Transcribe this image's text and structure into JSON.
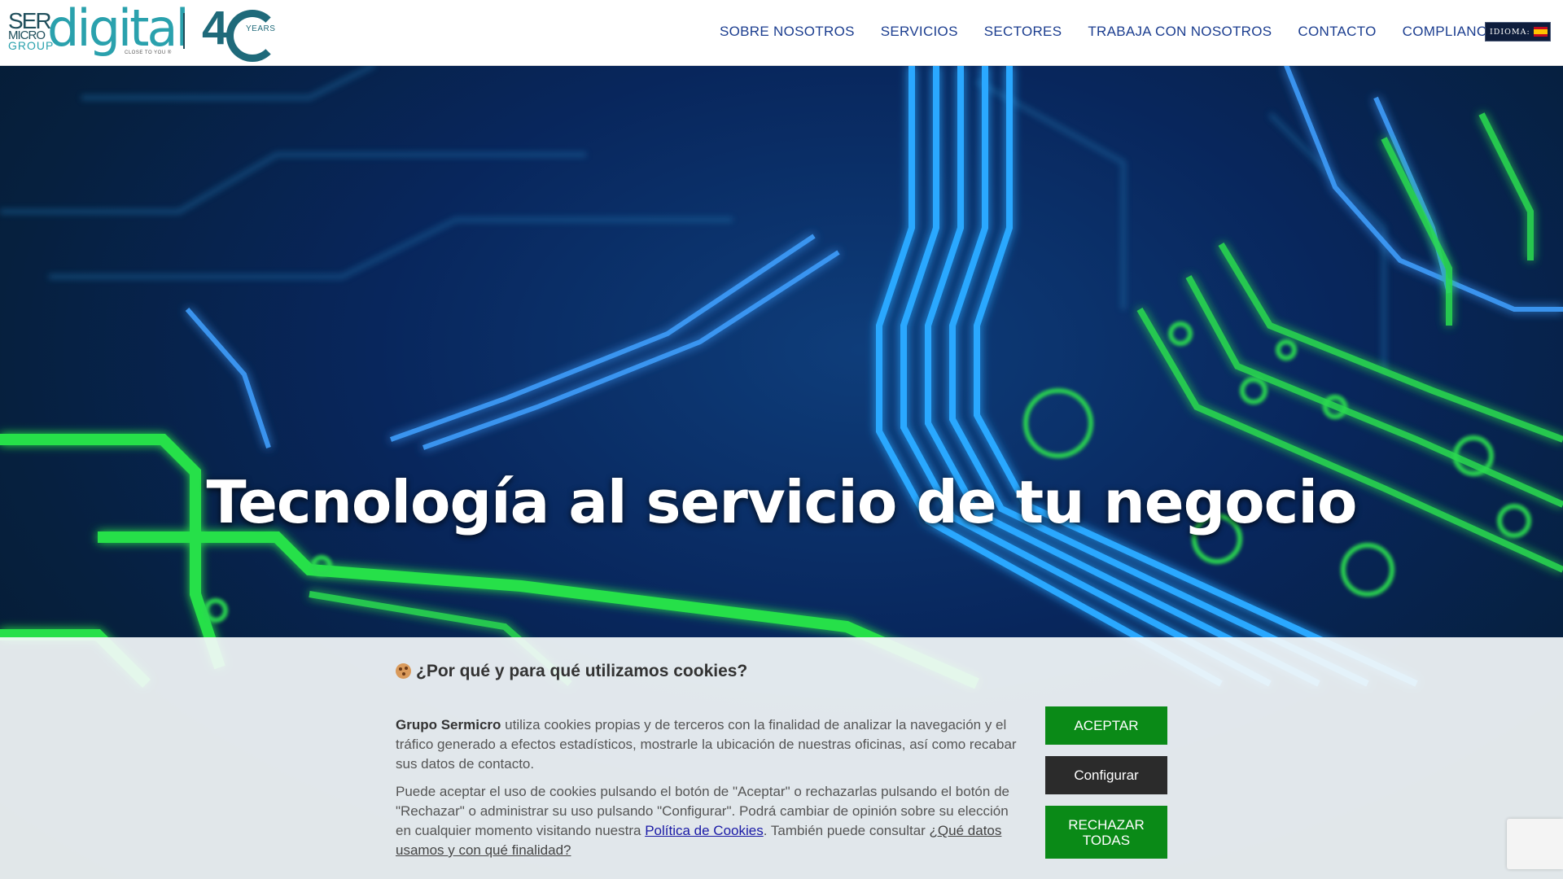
{
  "header": {
    "logo": {
      "ser": "SER",
      "micro": "MICRO",
      "group": "GROUP",
      "digital": "digital",
      "tagline": "CLOSE TO YOU ®",
      "anniversary_number": "4",
      "anniversary_years": "YEARS"
    },
    "nav": [
      {
        "label": "SOBRE NOSOTROS"
      },
      {
        "label": "SERVICIOS"
      },
      {
        "label": "SECTORES"
      },
      {
        "label": "TRABAJA CON NOSOTROS"
      },
      {
        "label": "CONTACTO"
      },
      {
        "label": "COMPLIANCE"
      }
    ],
    "language": {
      "label": "IDIOMA:",
      "flag": "spain-flag-icon"
    }
  },
  "hero": {
    "title": "Tecnología al servicio de tu negocio"
  },
  "cookie_banner": {
    "title": "¿Por qué y para qué utilizamos cookies?",
    "paragraph1_bold": "Grupo Sermicro",
    "paragraph1_rest": " utiliza cookies propias y de terceros con la finalidad de analizar la navegación y el tráfico generado a efectos estadísticos, mostrarle la ubicación de nuestras oficinas, así como recabar sus datos de contacto.",
    "paragraph2_start": "Puede aceptar el uso de cookies pulsando el botón de \"Aceptar\" o rechazarlas pulsando el botón de \"Rechazar\" o administrar su uso pulsando \"Configurar\". Podrá cambiar de opinión sobre su elección en cualquier momento visitando nuestra ",
    "policy_link": "Política de Cookies",
    "paragraph2_mid": ". También puede consultar ",
    "data_link": "¿Qué datos usamos y con qué finalidad?",
    "buttons": {
      "accept": "ACEPTAR",
      "configure": "Configurar",
      "reject": "RECHAZAR TODAS"
    }
  },
  "colors": {
    "nav_text": "#1b3d8f",
    "brand_teal": "#2aa1ad",
    "accept_green": "#0a8a17",
    "configure_dark": "#2b2b2b"
  }
}
